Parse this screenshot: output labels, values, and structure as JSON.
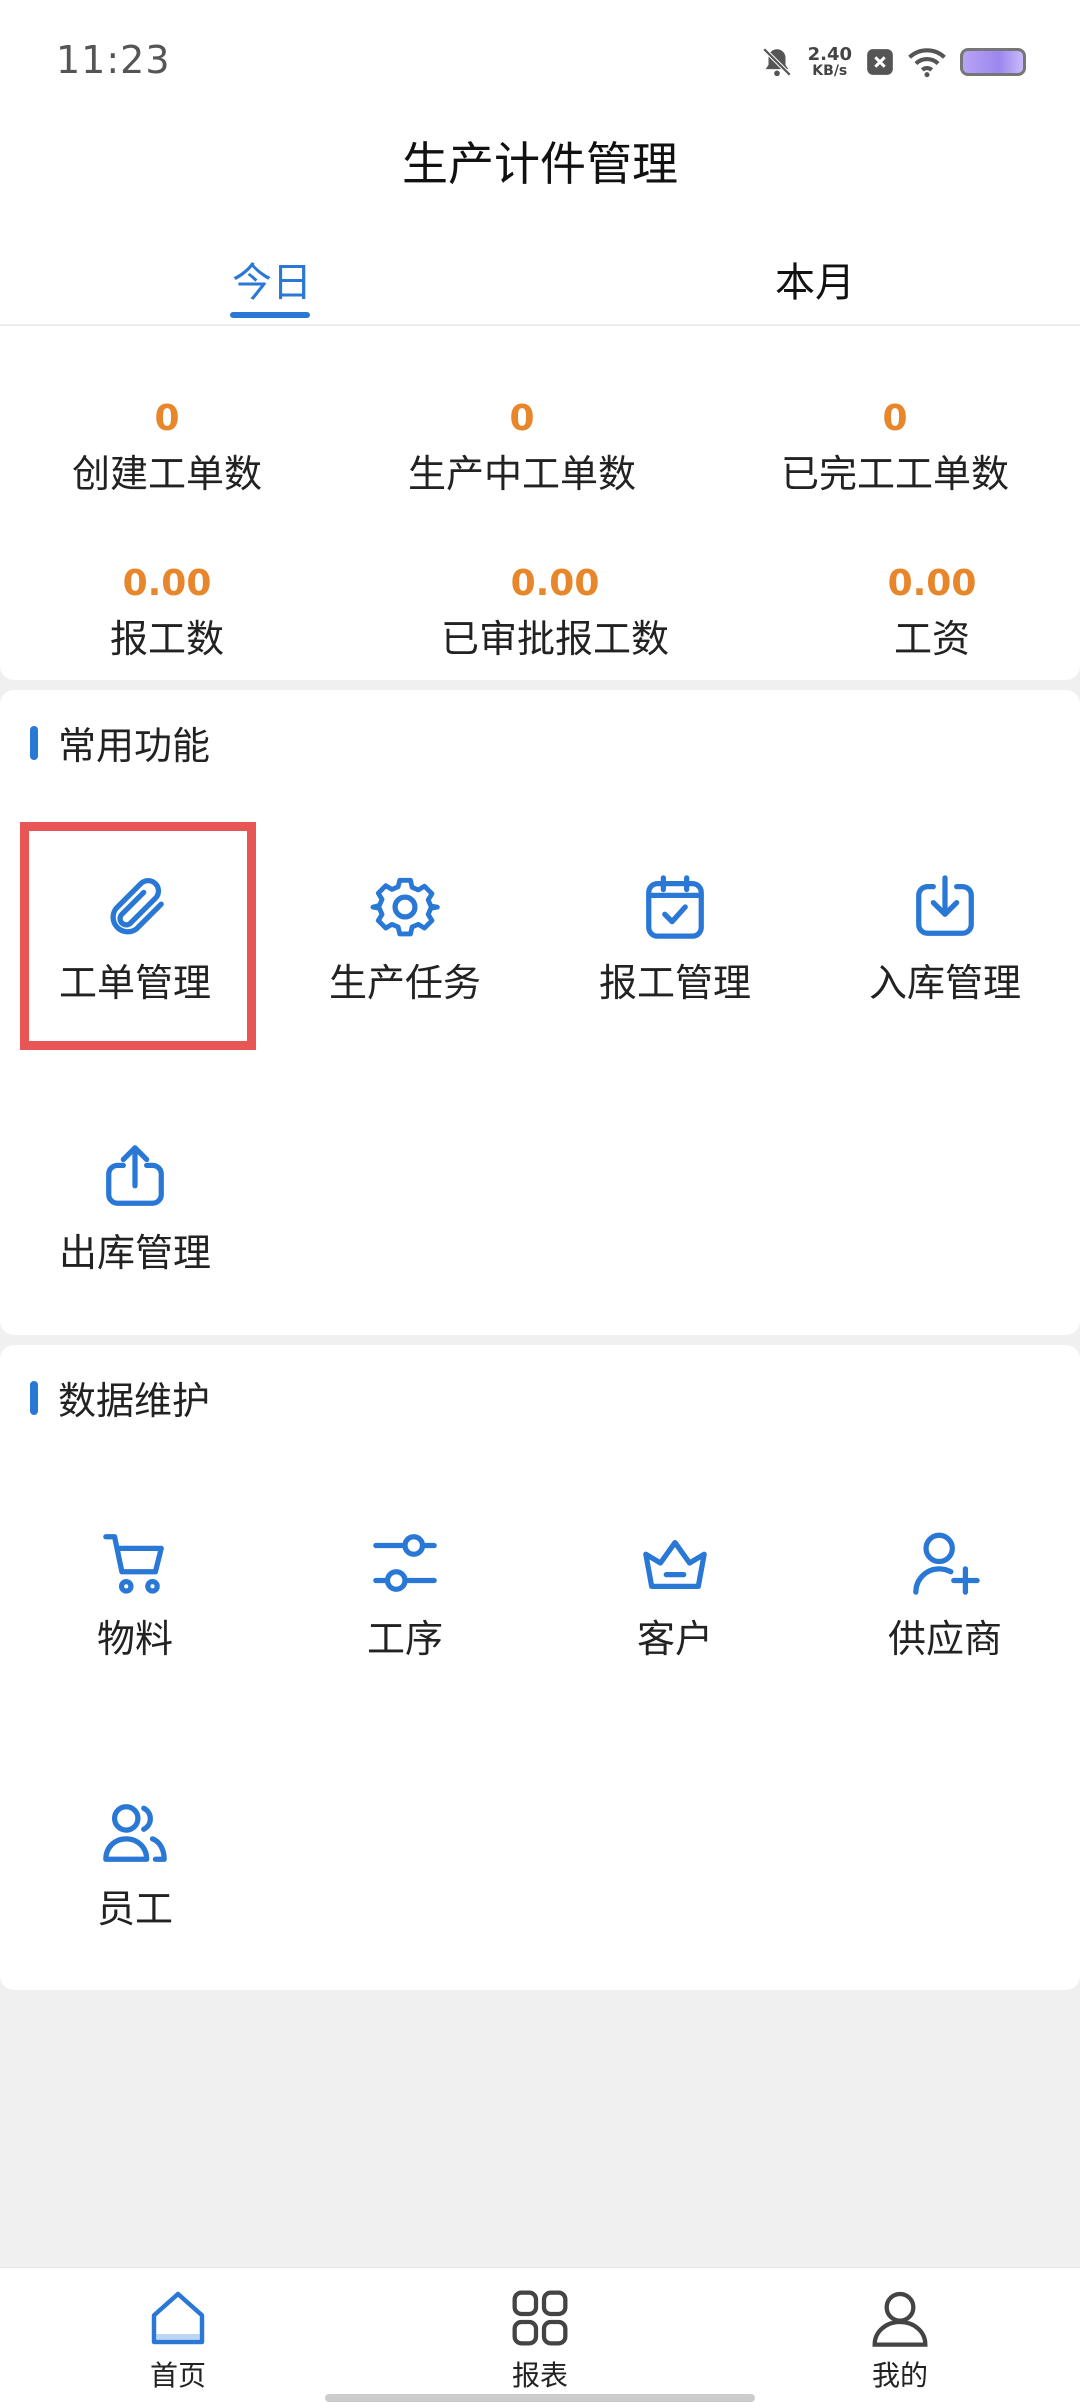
{
  "status": {
    "time": "11:23",
    "net_speed": "2.40",
    "net_unit": "KB/s"
  },
  "header": {
    "title": "生产计件管理"
  },
  "tabs": [
    {
      "label": "今日"
    },
    {
      "label": "本月"
    }
  ],
  "stats": [
    {
      "value": "0",
      "label": "创建工单数"
    },
    {
      "value": "0",
      "label": "生产中工单数"
    },
    {
      "value": "0",
      "label": "已完工工单数"
    },
    {
      "value": "0.00",
      "label": "报工数"
    },
    {
      "value": "0.00",
      "label": "已审批报工数"
    },
    {
      "value": "0.00",
      "label": "工资"
    }
  ],
  "common": {
    "title": "常用功能",
    "items": [
      {
        "label": "工单管理",
        "icon": "paperclip-icon"
      },
      {
        "label": "生产任务",
        "icon": "gear-icon"
      },
      {
        "label": "报工管理",
        "icon": "calendar-check-icon"
      },
      {
        "label": "入库管理",
        "icon": "inbox-download-icon"
      },
      {
        "label": "出库管理",
        "icon": "upload-icon"
      }
    ]
  },
  "maintenance": {
    "title": "数据维护",
    "items": [
      {
        "label": "物料",
        "icon": "cart-icon"
      },
      {
        "label": "工序",
        "icon": "sliders-icon"
      },
      {
        "label": "客户",
        "icon": "basket-icon"
      },
      {
        "label": "供应商",
        "icon": "user-plus-icon"
      },
      {
        "label": "员工",
        "icon": "users-icon"
      }
    ]
  },
  "nav": [
    {
      "label": "首页",
      "icon": "home-icon",
      "active": true
    },
    {
      "label": "报表",
      "icon": "grid-icon",
      "active": false
    },
    {
      "label": "我的",
      "icon": "user-icon",
      "active": false
    }
  ],
  "colors": {
    "accent": "#2a78d6",
    "stat_value": "#e7862a",
    "highlight": "#e85555"
  }
}
